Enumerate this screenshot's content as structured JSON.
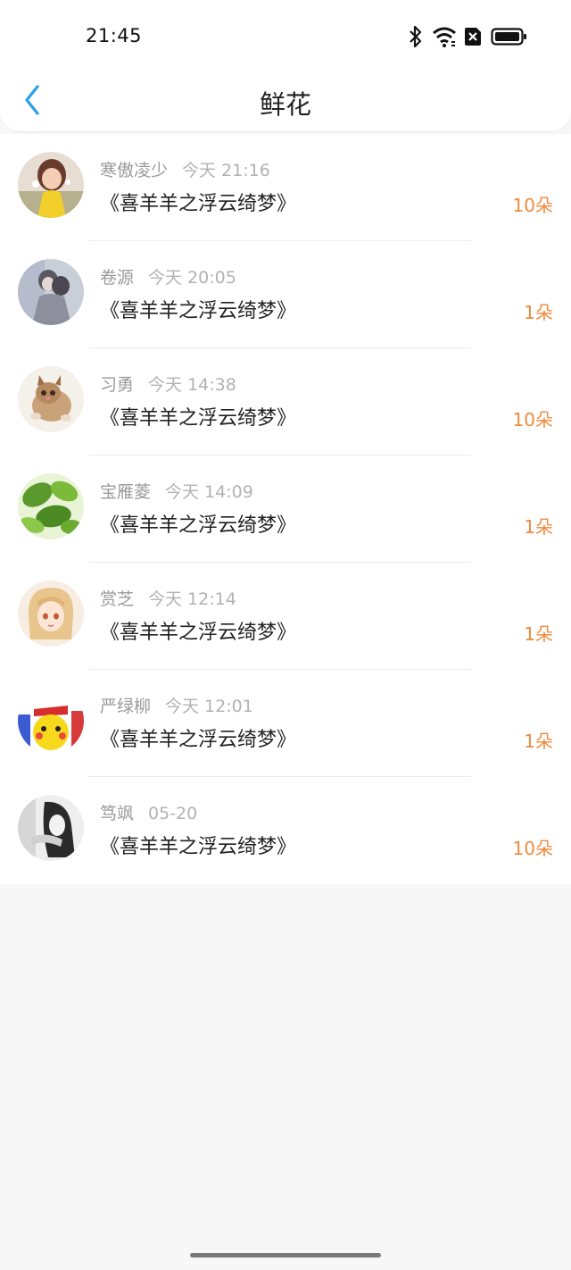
{
  "status_bar": {
    "time": "21:45",
    "icons": [
      "bluetooth-icon",
      "wifi-icon",
      "sim-off-icon",
      "battery-icon"
    ]
  },
  "title_bar": {
    "back_icon": "chevron-left-icon",
    "title": "鲜花"
  },
  "colors": {
    "accent": "#2a9ee8",
    "count": "#f08a3c",
    "meta": "#9a9a9a",
    "book": "#222222"
  },
  "records": [
    {
      "name": "寒傲凌少",
      "time": "今天 21:16",
      "book": "《喜羊羊之浮云绮梦》",
      "count": "10朵",
      "avatar": "girl-yellow-dress"
    },
    {
      "name": "卷源",
      "time": "今天 20:05",
      "book": "《喜羊羊之浮云绮梦》",
      "count": "1朵",
      "avatar": "couple-gray"
    },
    {
      "name": "习勇",
      "time": "今天 14:38",
      "book": "《喜羊羊之浮云绮梦》",
      "count": "10朵",
      "avatar": "kitten"
    },
    {
      "name": "宝雁菱",
      "time": "今天 14:09",
      "book": "《喜羊羊之浮云绮梦》",
      "count": "1朵",
      "avatar": "green-leaves"
    },
    {
      "name": "赏芝",
      "time": "今天 12:14",
      "book": "《喜羊羊之浮云绮梦》",
      "count": "1朵",
      "avatar": "anime-girl"
    },
    {
      "name": "严绿柳",
      "time": "今天 12:01",
      "book": "《喜羊羊之浮云绮梦》",
      "count": "1朵",
      "avatar": "pikachu"
    },
    {
      "name": "笃飒",
      "time": "05-20",
      "book": "《喜羊羊之浮云绮梦》",
      "count": "10朵",
      "avatar": "girl-bw"
    }
  ]
}
